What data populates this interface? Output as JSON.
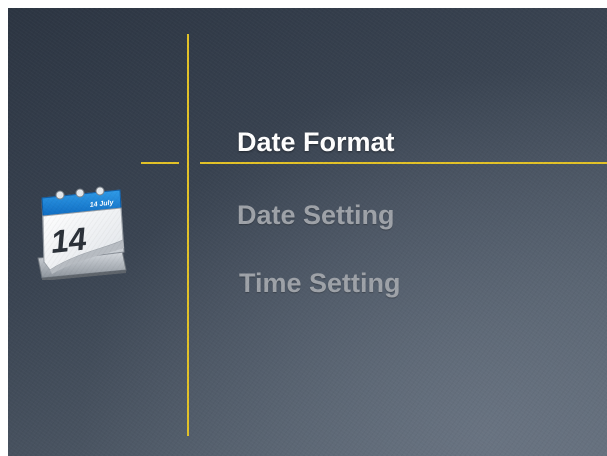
{
  "menu": {
    "items": [
      {
        "label": "Date Format",
        "selected": true
      },
      {
        "label": "Date Setting",
        "selected": false
      },
      {
        "label": "Time Setting",
        "selected": false
      }
    ]
  },
  "icon": {
    "name": "calendar-icon",
    "day": "14",
    "month": "July"
  },
  "colors": {
    "accent_line": "#e3c227",
    "selected_text": "#ffffff",
    "dim_text": "#9ea2a8",
    "background": "#3a4452"
  }
}
